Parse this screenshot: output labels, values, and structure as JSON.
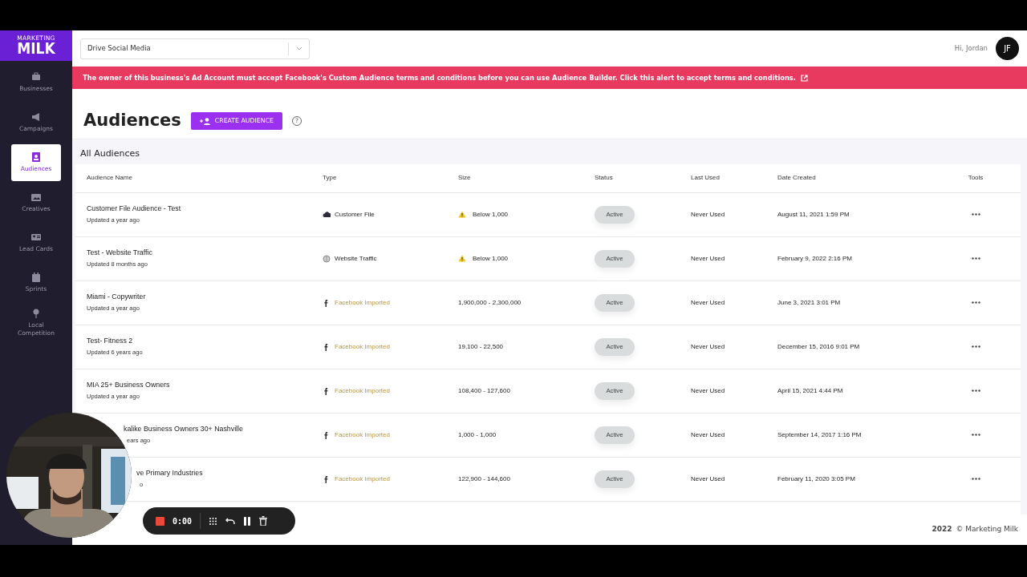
{
  "sidebar": {
    "logo_top": "MARKETING",
    "logo": "MILK",
    "items": [
      {
        "label": "Businesses",
        "selected": false
      },
      {
        "label": "Campaigns",
        "selected": false
      },
      {
        "label": "Audiences",
        "selected": true
      },
      {
        "label": "Creatives",
        "selected": false
      },
      {
        "label": "Lead Cards",
        "selected": false
      },
      {
        "label": "Sprints",
        "selected": false
      },
      {
        "label": "Local Competition",
        "selected": false
      }
    ]
  },
  "header": {
    "business_select": "Drive Social Media",
    "greeting": "Hi, Jordan",
    "avatar": "JF"
  },
  "alert": "The owner of this business's Ad Account must accept Facebook's Custom Audience terms and conditions before you can use Audience Builder. Click this alert to accept terms and conditions.",
  "page": {
    "title": "Audiences",
    "create_button": "CREATE AUDIENCE",
    "help": "?"
  },
  "table": {
    "title": "All Audiences",
    "columns": [
      "Audience Name",
      "Type",
      "Size",
      "Status",
      "Last Used",
      "Date Created",
      "Tools"
    ],
    "rows": [
      {
        "name": "Customer File Audience - Test",
        "updated": "Updated a year ago",
        "type": {
          "kind": "customer_file",
          "label": "Customer File"
        },
        "size": "Below 1,000",
        "warning": true,
        "status": "Active",
        "last_used": "Never Used",
        "date_created": "August 11, 2021 1:59 PM"
      },
      {
        "name": "Test - Website Traffic",
        "updated": "Updated 8 months ago",
        "type": {
          "kind": "website",
          "label": "Website Traffic"
        },
        "size": "Below 1,000",
        "warning": true,
        "status": "Active",
        "last_used": "Never Used",
        "date_created": "February 9, 2022 2:16 PM"
      },
      {
        "name": "Miami - Copywriter",
        "updated": "Updated a year ago",
        "type": {
          "kind": "facebook",
          "label": "Facebook Imported"
        },
        "size": "1,900,000 - 2,300,000",
        "warning": false,
        "status": "Active",
        "last_used": "Never Used",
        "date_created": "June 3, 2021 3:01 PM"
      },
      {
        "name": "Test- Fitness 2",
        "updated": "Updated 6 years ago",
        "type": {
          "kind": "facebook",
          "label": "Facebook Imported"
        },
        "size": "19,100 - 22,500",
        "warning": false,
        "status": "Active",
        "last_used": "Never Used",
        "date_created": "December 15, 2016 9:01 PM"
      },
      {
        "name": "MIA 25+ Business Owners",
        "updated": "Updated a year ago",
        "type": {
          "kind": "facebook",
          "label": "Facebook Imported"
        },
        "size": "108,400 - 127,600",
        "warning": false,
        "status": "Active",
        "last_used": "Never Used",
        "date_created": "April 15, 2021 4:44 PM"
      },
      {
        "name": "kalike Business Owners 30+ Nashville",
        "updated": "ears ago",
        "type": {
          "kind": "facebook",
          "label": "Facebook Imported"
        },
        "size": "1,000 - 1,000",
        "warning": false,
        "status": "Active",
        "last_used": "Never Used",
        "date_created": "September 14, 2017 1:16 PM"
      },
      {
        "name": "ve Primary Industries",
        "updated": "o",
        "type": {
          "kind": "facebook",
          "label": "Facebook Imported"
        },
        "size": "122,900 - 144,600",
        "warning": false,
        "status": "Active",
        "last_used": "Never Used",
        "date_created": "February 11, 2020 3:05 PM"
      }
    ]
  },
  "footer": {
    "year": "2022",
    "copyright": "© Marketing Milk"
  },
  "recorder": {
    "time": "0:00"
  }
}
